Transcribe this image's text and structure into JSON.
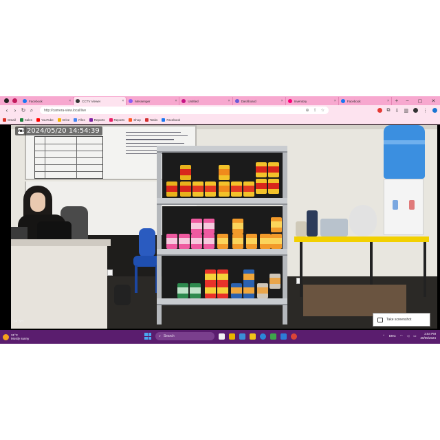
{
  "browser": {
    "tabs": [
      {
        "label": "Facebook",
        "color": "#1877f2"
      },
      {
        "label": "CCTV Viewer",
        "color": "#333333"
      },
      {
        "label": "Messenger",
        "color": "#8a5cf6"
      },
      {
        "label": "Untitled",
        "color": "#c71585"
      },
      {
        "label": "Dashboard",
        "color": "#6b5bd6"
      },
      {
        "label": "Inventory",
        "color": "#f07"
      },
      {
        "label": "Facebook",
        "color": "#1877f2"
      }
    ],
    "active_tab_index": 1,
    "url": "http://camera-view.local/live",
    "bookmarks": [
      {
        "label": "Gmail",
        "color": "#d93025"
      },
      {
        "label": "Sales",
        "color": "#188038"
      },
      {
        "label": "YouTube",
        "color": "#ff0000"
      },
      {
        "label": "Drive",
        "color": "#f4b400"
      },
      {
        "label": "Files",
        "color": "#4285f4"
      },
      {
        "label": "Reports",
        "color": "#7b1fa2"
      },
      {
        "label": "Reports",
        "color": "#e91e63"
      },
      {
        "label": "Shop",
        "color": "#ff5722"
      },
      {
        "label": "Tasks",
        "color": "#d32f2f"
      },
      {
        "label": "Facebook",
        "color": "#1877f2"
      }
    ]
  },
  "video": {
    "timestamp": "2024/05/20  14:54:39",
    "ts_icon": "mi",
    "corner_label": "34.5H",
    "take_button": "Take screenshot"
  },
  "taskbar": {
    "weather_temp": "31°C",
    "weather_desc": "Mostly sunny",
    "search_placeholder": "Search",
    "time": "2:54 PM",
    "date": "20/05/2024",
    "lang": "ENG"
  }
}
